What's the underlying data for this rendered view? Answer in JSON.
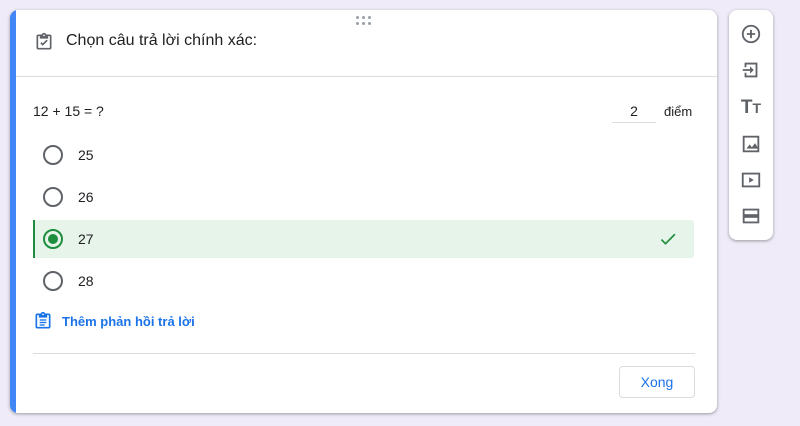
{
  "question_card": {
    "section_title": "Chọn câu trả lời chính xác:",
    "question": "12 + 15 = ?",
    "points_value": "2",
    "points_label": "điểm",
    "options": [
      {
        "label": "25",
        "correct": false
      },
      {
        "label": "26",
        "correct": false
      },
      {
        "label": "27",
        "correct": true
      },
      {
        "label": "28",
        "correct": false
      }
    ],
    "feedback_label": "Thêm phản hồi trả lời",
    "done_label": "Xong",
    "accent_color": "#4285f4",
    "correct_color": "#1e8e3e"
  },
  "toolbar": {
    "items": [
      {
        "name": "add-question",
        "icon": "plus-circle-icon"
      },
      {
        "name": "import-questions",
        "icon": "import-icon"
      },
      {
        "name": "add-title-description",
        "icon": "title-text-icon",
        "glyph_big": "T",
        "glyph_small": "T"
      },
      {
        "name": "add-image",
        "icon": "image-icon"
      },
      {
        "name": "add-video",
        "icon": "video-icon"
      },
      {
        "name": "add-section",
        "icon": "section-icon"
      }
    ]
  }
}
